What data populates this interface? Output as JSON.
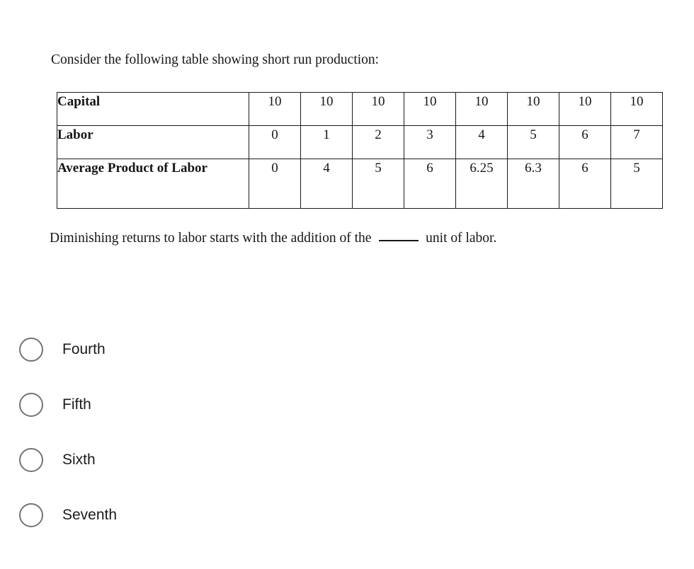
{
  "question": {
    "stem": "Consider the following table showing short run production:",
    "prompt_before_blank": "Diminishing returns to labor starts with the addition of the",
    "prompt_after_blank": "unit of labor."
  },
  "table": {
    "rows": [
      {
        "label": "Capital",
        "values": [
          "10",
          "10",
          "10",
          "10",
          "10",
          "10",
          "10",
          "10"
        ]
      },
      {
        "label": "Labor",
        "values": [
          "0",
          "1",
          "2",
          "3",
          "4",
          "5",
          "6",
          "7"
        ]
      },
      {
        "label": "Average Product of Labor",
        "values": [
          "0",
          "4",
          "5",
          "6",
          "6.25",
          "6.3",
          "6",
          "5"
        ]
      }
    ]
  },
  "choices": [
    {
      "label": "Fourth",
      "selected": false
    },
    {
      "label": "Fifth",
      "selected": false
    },
    {
      "label": "Sixth",
      "selected": false
    },
    {
      "label": "Seventh",
      "selected": false
    }
  ],
  "chart_data": {
    "type": "table",
    "title": "Short run production",
    "categories": [
      "0",
      "1",
      "2",
      "3",
      "4",
      "5",
      "6",
      "7"
    ],
    "xlabel": "Labor",
    "ylabel": "Average Product of Labor",
    "series": [
      {
        "name": "Capital",
        "values": [
          10,
          10,
          10,
          10,
          10,
          10,
          10,
          10
        ]
      },
      {
        "name": "Labor",
        "values": [
          0,
          1,
          2,
          3,
          4,
          5,
          6,
          7
        ]
      },
      {
        "name": "Average Product of Labor",
        "values": [
          0,
          4,
          5,
          6,
          6.25,
          6.3,
          6,
          5
        ]
      }
    ]
  }
}
